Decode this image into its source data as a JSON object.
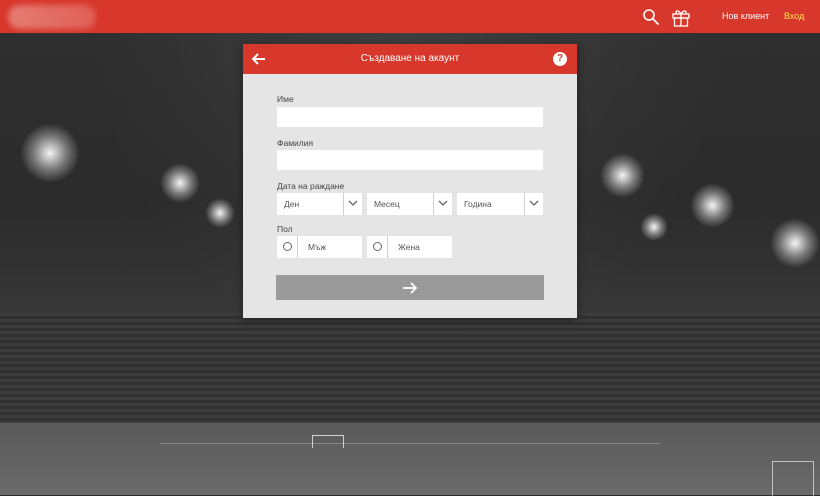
{
  "header": {
    "nav_new_client": "Нов клиент",
    "nav_login": "Вход",
    "icons": [
      "search-icon",
      "gift-icon"
    ],
    "colors": {
      "brand": "#d8372b",
      "login_link": "#ffe14d"
    }
  },
  "modal": {
    "title": "Създаване на акаунт",
    "help_symbol": "?",
    "fields": {
      "first_name_label": "Име",
      "first_name_value": "",
      "last_name_label": "Фамилия",
      "last_name_value": "",
      "birth_date_label": "Дата на раждане",
      "day_placeholder": "Ден",
      "month_placeholder": "Месец",
      "year_placeholder": "Година",
      "gender_label": "Пол",
      "gender_male": "Мъж",
      "gender_female": "Жена"
    },
    "submit_icon": "arrow-right-icon"
  }
}
